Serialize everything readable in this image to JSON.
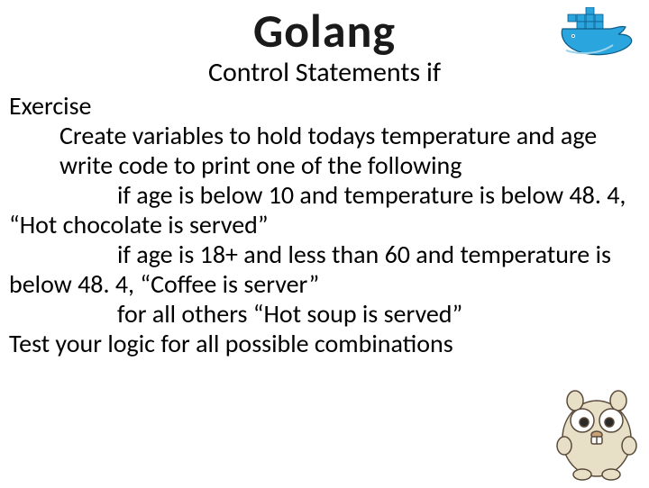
{
  "title": "Golang",
  "subtitle": "Control Statements if",
  "lines": {
    "l1": "Exercise",
    "l2": "Create variables to hold todays temperature and age",
    "l3": "write code to print one of the following",
    "l4": "if age is below 10 and temperature is below 48. 4, “Hot chocolate is served”",
    "l5": "if age is 18+ and less than 60 and temperature is below 48. 4, “Coffee is server”",
    "l6": "for all others “Hot soup is served”",
    "l7": "Test your logic for all possible combinations"
  },
  "icons": {
    "docker": "docker-whale-icon",
    "gopher": "golang-gopher-icon"
  }
}
